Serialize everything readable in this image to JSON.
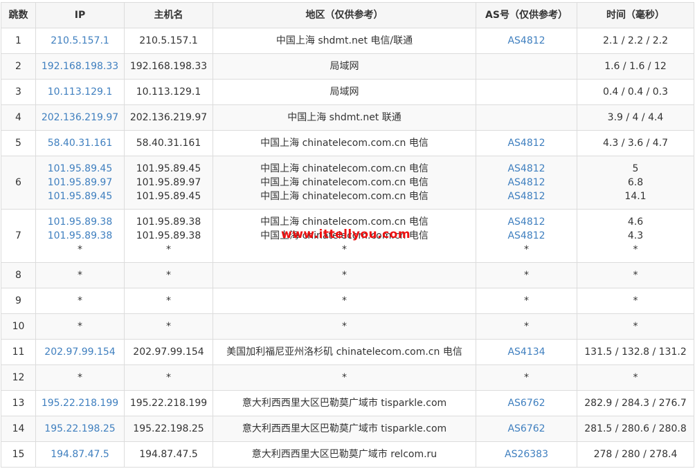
{
  "headers": [
    "跳数",
    "IP",
    "主机名",
    "地区（仅供参考）",
    "AS号（仅供参考）",
    "时间（毫秒）"
  ],
  "rows": [
    {
      "hop": "1",
      "ip": [
        "210.5.157.1"
      ],
      "host": [
        "210.5.157.1"
      ],
      "region": [
        "中国上海 shdmt.net 电信/联通"
      ],
      "asn": [
        "AS4812"
      ],
      "time": [
        "2.1 / 2.2 / 2.2"
      ]
    },
    {
      "hop": "2",
      "ip": [
        "192.168.198.33"
      ],
      "host": [
        "192.168.198.33"
      ],
      "region": [
        "局域网"
      ],
      "asn": [
        ""
      ],
      "time": [
        "1.6 / 1.6 / 12"
      ]
    },
    {
      "hop": "3",
      "ip": [
        "10.113.129.1"
      ],
      "host": [
        "10.113.129.1"
      ],
      "region": [
        "局域网"
      ],
      "asn": [
        ""
      ],
      "time": [
        "0.4 / 0.4 / 0.3"
      ]
    },
    {
      "hop": "4",
      "ip": [
        "202.136.219.97"
      ],
      "host": [
        "202.136.219.97"
      ],
      "region": [
        "中国上海 shdmt.net 联通"
      ],
      "asn": [
        ""
      ],
      "time": [
        "3.9 / 4 / 4.4"
      ]
    },
    {
      "hop": "5",
      "ip": [
        "58.40.31.161"
      ],
      "host": [
        "58.40.31.161"
      ],
      "region": [
        "中国上海 chinatelecom.com.cn 电信"
      ],
      "asn": [
        "AS4812"
      ],
      "time": [
        "4.3 / 3.6 / 4.7"
      ]
    },
    {
      "hop": "6",
      "ip": [
        "101.95.89.45",
        "101.95.89.97",
        "101.95.89.45"
      ],
      "host": [
        "101.95.89.45",
        "101.95.89.97",
        "101.95.89.45"
      ],
      "region": [
        "中国上海 chinatelecom.com.cn 电信",
        "中国上海 chinatelecom.com.cn 电信",
        "中国上海 chinatelecom.com.cn 电信"
      ],
      "asn": [
        "AS4812",
        "AS4812",
        "AS4812"
      ],
      "time": [
        "5",
        "6.8",
        "14.1"
      ]
    },
    {
      "hop": "7",
      "ip": [
        "101.95.89.38",
        "101.95.89.38",
        "*"
      ],
      "host": [
        "101.95.89.38",
        "101.95.89.38",
        "*"
      ],
      "region": [
        "中国上海 chinatelecom.com.cn 电信",
        "中国上海 chinatelecom.com.cn 电信",
        "*"
      ],
      "asn": [
        "AS4812",
        "AS4812",
        "*"
      ],
      "time": [
        "4.6",
        "4.3",
        "*"
      ]
    },
    {
      "hop": "8",
      "ip": [
        "*"
      ],
      "host": [
        "*"
      ],
      "region": [
        "*"
      ],
      "asn": [
        "*"
      ],
      "time": [
        "*"
      ]
    },
    {
      "hop": "9",
      "ip": [
        "*"
      ],
      "host": [
        "*"
      ],
      "region": [
        "*"
      ],
      "asn": [
        "*"
      ],
      "time": [
        "*"
      ]
    },
    {
      "hop": "10",
      "ip": [
        "*"
      ],
      "host": [
        "*"
      ],
      "region": [
        "*"
      ],
      "asn": [
        "*"
      ],
      "time": [
        "*"
      ]
    },
    {
      "hop": "11",
      "ip": [
        "202.97.99.154"
      ],
      "host": [
        "202.97.99.154"
      ],
      "region": [
        "美国加利福尼亚州洛杉矶 chinatelecom.com.cn 电信"
      ],
      "asn": [
        "AS4134"
      ],
      "time": [
        "131.5 / 132.8 / 131.2"
      ]
    },
    {
      "hop": "12",
      "ip": [
        "*"
      ],
      "host": [
        "*"
      ],
      "region": [
        "*"
      ],
      "asn": [
        "*"
      ],
      "time": [
        "*"
      ]
    },
    {
      "hop": "13",
      "ip": [
        "195.22.218.199"
      ],
      "host": [
        "195.22.218.199"
      ],
      "region": [
        "意大利西西里大区巴勒莫广域市 tisparkle.com"
      ],
      "asn": [
        "AS6762"
      ],
      "time": [
        "282.9 / 284.3 / 276.7"
      ]
    },
    {
      "hop": "14",
      "ip": [
        "195.22.198.25"
      ],
      "host": [
        "195.22.198.25"
      ],
      "region": [
        "意大利西西里大区巴勒莫广域市 tisparkle.com"
      ],
      "asn": [
        "AS6762"
      ],
      "time": [
        "281.5 / 280.6 / 280.8"
      ]
    },
    {
      "hop": "15",
      "ip": [
        "194.87.47.5"
      ],
      "host": [
        "194.87.47.5"
      ],
      "region": [
        "意大利西西里大区巴勒莫广域市 relcom.ru"
      ],
      "asn": [
        "AS26383"
      ],
      "time": [
        "278 / 280 / 278.4"
      ]
    }
  ],
  "watermark": "www.ittellyou.com",
  "colors": {
    "link": "#3f7fbf",
    "watermark": "#ee1111",
    "border": "#dcdcdc"
  }
}
